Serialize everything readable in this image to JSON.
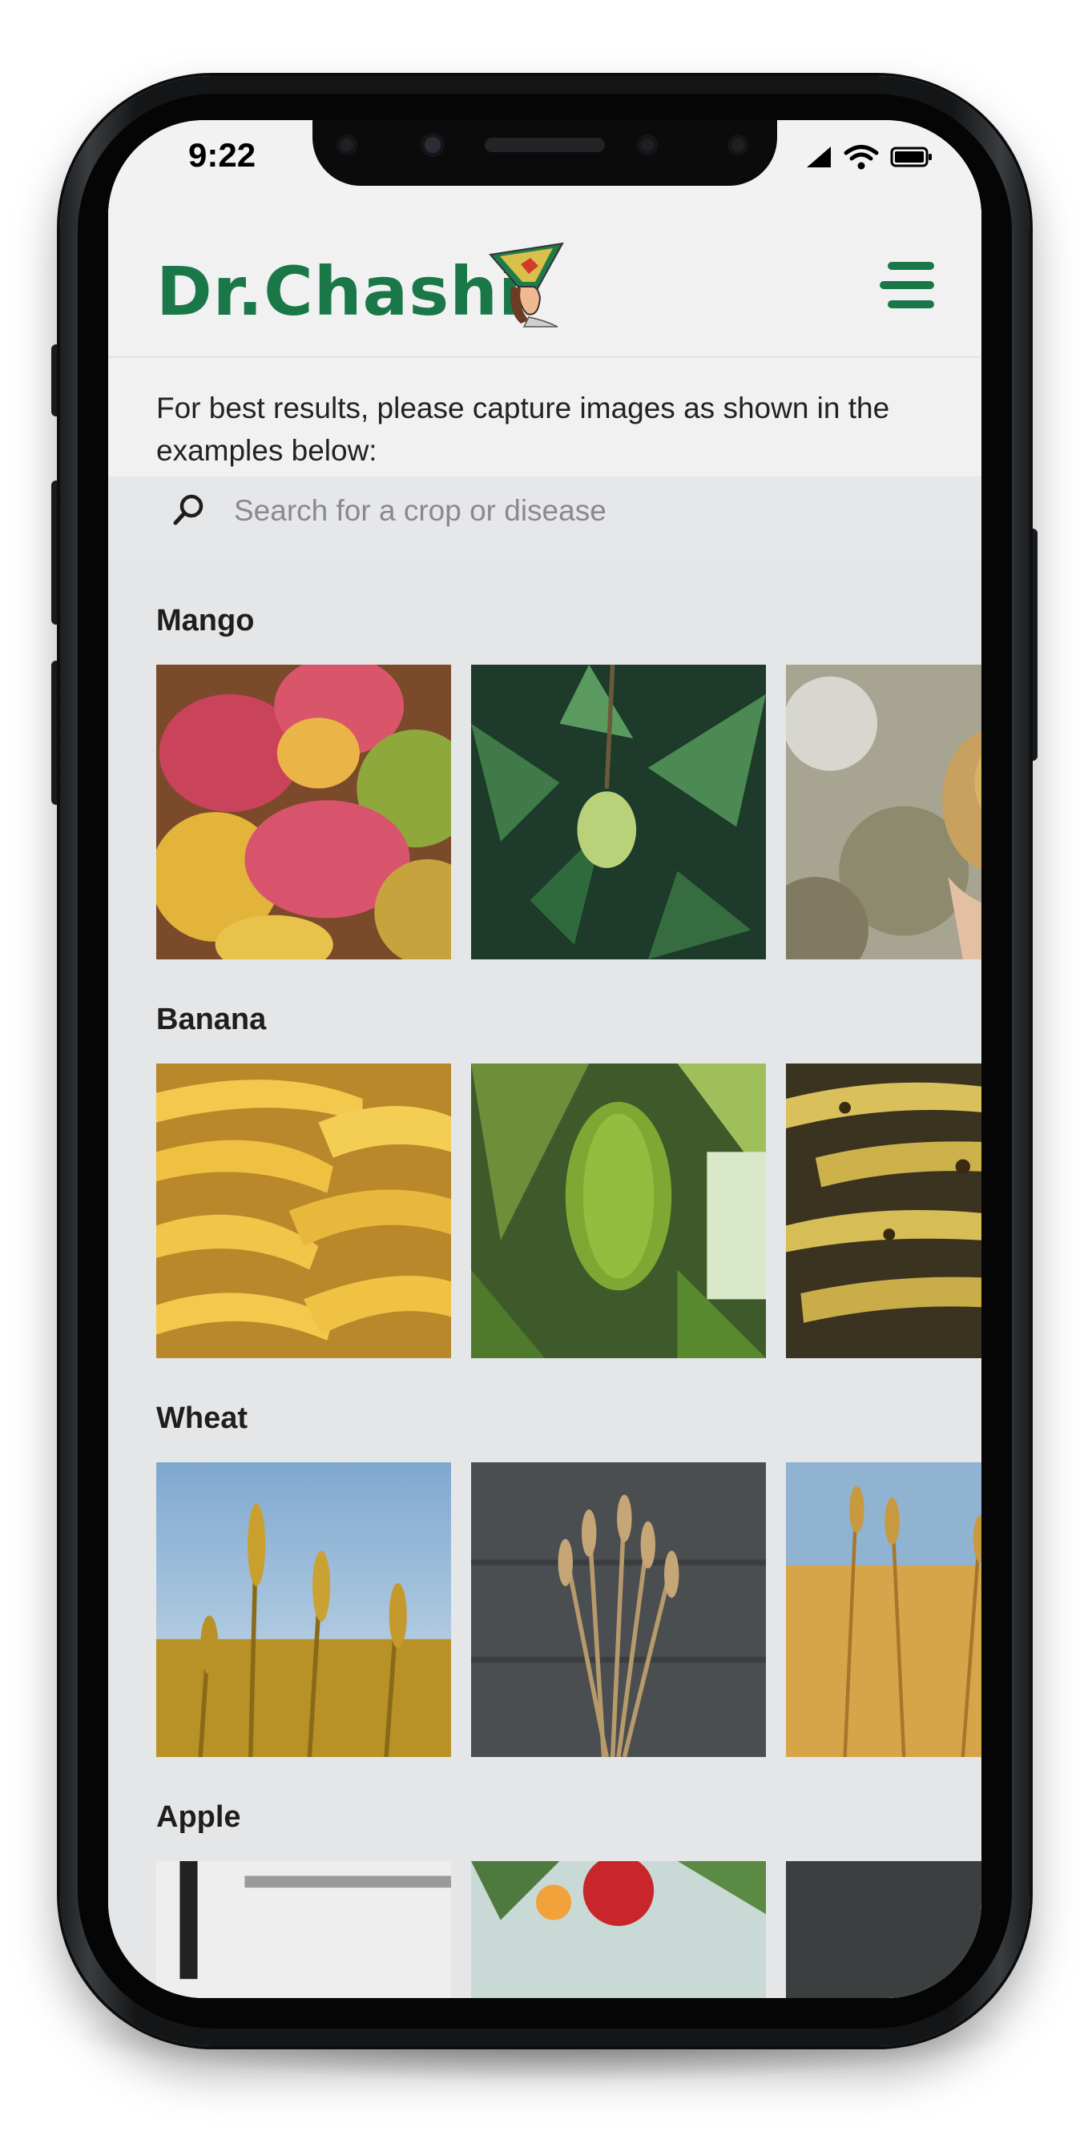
{
  "status_bar": {
    "time": "9:22",
    "icons": [
      "signal-icon",
      "wifi-icon",
      "battery-icon"
    ]
  },
  "header": {
    "logo_text": "Dr.Chashi",
    "mascot_icon": "farmer-mascot-icon",
    "menu_icon": "hamburger-menu-icon",
    "brand_color": "#1a7848"
  },
  "instructions": "For best results, please capture images as shown in the examples below:",
  "search": {
    "placeholder": "Search for a crop or disease",
    "value": "",
    "icon": "search-icon"
  },
  "crops": [
    {
      "name": "Mango",
      "images": [
        "mango-pile-photo",
        "mango-on-tree-photo",
        "mango-in-hand-photo"
      ]
    },
    {
      "name": "Banana",
      "images": [
        "banana-pile-photo",
        "banana-bunch-on-plant-photo",
        "ripe-spotted-bananas-photo"
      ]
    },
    {
      "name": "Wheat",
      "images": [
        "wheat-field-sky-photo",
        "wheat-stalks-on-wood-photo",
        "golden-wheat-field-photo"
      ]
    },
    {
      "name": "Apple",
      "images": [
        "apple-orchard-photo",
        "apple-on-branch-photo",
        "apple-dark-photo"
      ]
    }
  ]
}
